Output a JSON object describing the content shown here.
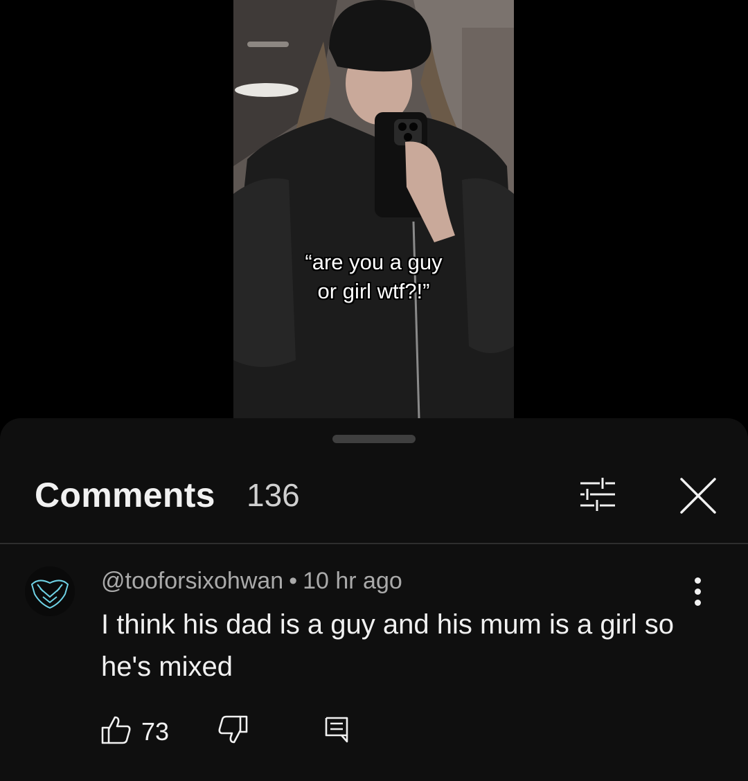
{
  "video": {
    "caption_line1": "“are you a guy",
    "caption_line2": "or girl wtf?!”"
  },
  "comments_panel": {
    "title": "Comments",
    "count": "136"
  },
  "comment": {
    "author": "@tooforsixohwan",
    "separator": "•",
    "time": "10 hr ago",
    "text": "I think his dad is a guy and his mum is a girl so he's mixed",
    "likes": "73"
  },
  "icons": {
    "filter": "sliders-icon",
    "close": "close-icon",
    "more": "more-vertical-icon",
    "like": "thumbs-up-icon",
    "dislike": "thumbs-down-icon",
    "reply": "reply-icon"
  },
  "colors": {
    "sheet_background": "#0f0f0f",
    "primary_text": "#f1f1f1",
    "secondary_text": "#aaaaaa",
    "avatar_accent": "#6fd3e6"
  }
}
